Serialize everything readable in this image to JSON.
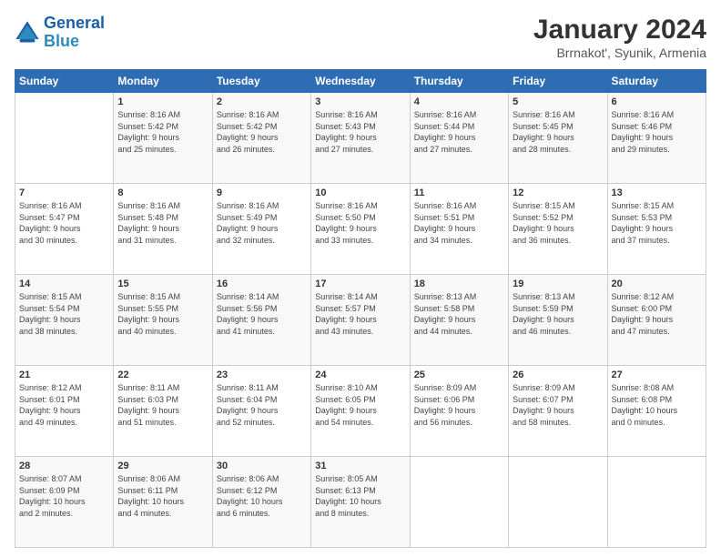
{
  "header": {
    "logo_line1": "General",
    "logo_line2": "Blue",
    "main_title": "January 2024",
    "subtitle": "Brrnakot', Syunik, Armenia"
  },
  "days_of_week": [
    "Sunday",
    "Monday",
    "Tuesday",
    "Wednesday",
    "Thursday",
    "Friday",
    "Saturday"
  ],
  "weeks": [
    [
      {
        "day": "",
        "info": ""
      },
      {
        "day": "1",
        "info": "Sunrise: 8:16 AM\nSunset: 5:42 PM\nDaylight: 9 hours\nand 25 minutes."
      },
      {
        "day": "2",
        "info": "Sunrise: 8:16 AM\nSunset: 5:42 PM\nDaylight: 9 hours\nand 26 minutes."
      },
      {
        "day": "3",
        "info": "Sunrise: 8:16 AM\nSunset: 5:43 PM\nDaylight: 9 hours\nand 27 minutes."
      },
      {
        "day": "4",
        "info": "Sunrise: 8:16 AM\nSunset: 5:44 PM\nDaylight: 9 hours\nand 27 minutes."
      },
      {
        "day": "5",
        "info": "Sunrise: 8:16 AM\nSunset: 5:45 PM\nDaylight: 9 hours\nand 28 minutes."
      },
      {
        "day": "6",
        "info": "Sunrise: 8:16 AM\nSunset: 5:46 PM\nDaylight: 9 hours\nand 29 minutes."
      }
    ],
    [
      {
        "day": "7",
        "info": "Sunrise: 8:16 AM\nSunset: 5:47 PM\nDaylight: 9 hours\nand 30 minutes."
      },
      {
        "day": "8",
        "info": "Sunrise: 8:16 AM\nSunset: 5:48 PM\nDaylight: 9 hours\nand 31 minutes."
      },
      {
        "day": "9",
        "info": "Sunrise: 8:16 AM\nSunset: 5:49 PM\nDaylight: 9 hours\nand 32 minutes."
      },
      {
        "day": "10",
        "info": "Sunrise: 8:16 AM\nSunset: 5:50 PM\nDaylight: 9 hours\nand 33 minutes."
      },
      {
        "day": "11",
        "info": "Sunrise: 8:16 AM\nSunset: 5:51 PM\nDaylight: 9 hours\nand 34 minutes."
      },
      {
        "day": "12",
        "info": "Sunrise: 8:15 AM\nSunset: 5:52 PM\nDaylight: 9 hours\nand 36 minutes."
      },
      {
        "day": "13",
        "info": "Sunrise: 8:15 AM\nSunset: 5:53 PM\nDaylight: 9 hours\nand 37 minutes."
      }
    ],
    [
      {
        "day": "14",
        "info": "Sunrise: 8:15 AM\nSunset: 5:54 PM\nDaylight: 9 hours\nand 38 minutes."
      },
      {
        "day": "15",
        "info": "Sunrise: 8:15 AM\nSunset: 5:55 PM\nDaylight: 9 hours\nand 40 minutes."
      },
      {
        "day": "16",
        "info": "Sunrise: 8:14 AM\nSunset: 5:56 PM\nDaylight: 9 hours\nand 41 minutes."
      },
      {
        "day": "17",
        "info": "Sunrise: 8:14 AM\nSunset: 5:57 PM\nDaylight: 9 hours\nand 43 minutes."
      },
      {
        "day": "18",
        "info": "Sunrise: 8:13 AM\nSunset: 5:58 PM\nDaylight: 9 hours\nand 44 minutes."
      },
      {
        "day": "19",
        "info": "Sunrise: 8:13 AM\nSunset: 5:59 PM\nDaylight: 9 hours\nand 46 minutes."
      },
      {
        "day": "20",
        "info": "Sunrise: 8:12 AM\nSunset: 6:00 PM\nDaylight: 9 hours\nand 47 minutes."
      }
    ],
    [
      {
        "day": "21",
        "info": "Sunrise: 8:12 AM\nSunset: 6:01 PM\nDaylight: 9 hours\nand 49 minutes."
      },
      {
        "day": "22",
        "info": "Sunrise: 8:11 AM\nSunset: 6:03 PM\nDaylight: 9 hours\nand 51 minutes."
      },
      {
        "day": "23",
        "info": "Sunrise: 8:11 AM\nSunset: 6:04 PM\nDaylight: 9 hours\nand 52 minutes."
      },
      {
        "day": "24",
        "info": "Sunrise: 8:10 AM\nSunset: 6:05 PM\nDaylight: 9 hours\nand 54 minutes."
      },
      {
        "day": "25",
        "info": "Sunrise: 8:09 AM\nSunset: 6:06 PM\nDaylight: 9 hours\nand 56 minutes."
      },
      {
        "day": "26",
        "info": "Sunrise: 8:09 AM\nSunset: 6:07 PM\nDaylight: 9 hours\nand 58 minutes."
      },
      {
        "day": "27",
        "info": "Sunrise: 8:08 AM\nSunset: 6:08 PM\nDaylight: 10 hours\nand 0 minutes."
      }
    ],
    [
      {
        "day": "28",
        "info": "Sunrise: 8:07 AM\nSunset: 6:09 PM\nDaylight: 10 hours\nand 2 minutes."
      },
      {
        "day": "29",
        "info": "Sunrise: 8:06 AM\nSunset: 6:11 PM\nDaylight: 10 hours\nand 4 minutes."
      },
      {
        "day": "30",
        "info": "Sunrise: 8:06 AM\nSunset: 6:12 PM\nDaylight: 10 hours\nand 6 minutes."
      },
      {
        "day": "31",
        "info": "Sunrise: 8:05 AM\nSunset: 6:13 PM\nDaylight: 10 hours\nand 8 minutes."
      },
      {
        "day": "",
        "info": ""
      },
      {
        "day": "",
        "info": ""
      },
      {
        "day": "",
        "info": ""
      }
    ]
  ]
}
